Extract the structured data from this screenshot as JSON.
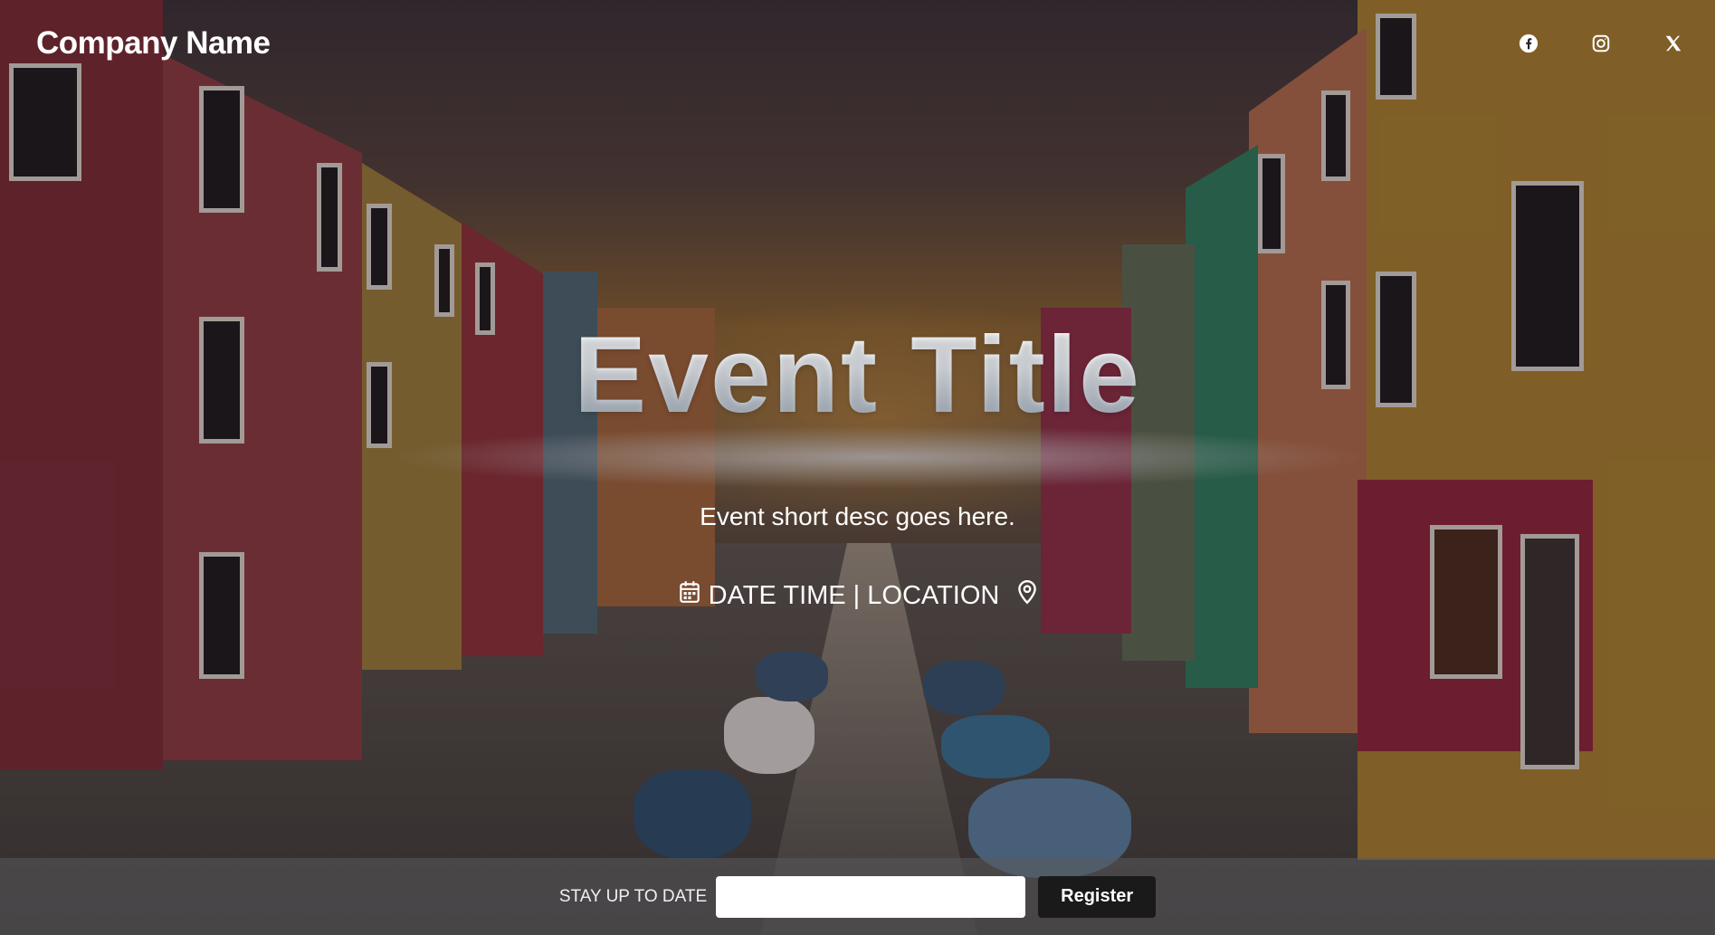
{
  "header": {
    "brand": "Company Name",
    "social": [
      {
        "name": "facebook-icon"
      },
      {
        "name": "instagram-icon"
      },
      {
        "name": "x-twitter-icon"
      }
    ]
  },
  "hero": {
    "title": "Event Title",
    "description": "Event short desc goes here.",
    "meta_text": "DATE TIME | LOCATION",
    "meta_icons": [
      "calendar-icon",
      "location-pin-icon"
    ]
  },
  "footer": {
    "label": "STAY UP TO DATE",
    "email_value": "",
    "email_placeholder": "",
    "button_label": "Register"
  },
  "colors": {
    "text": "#ffffff",
    "footer_bar": "#5a5a5c",
    "button_bg": "#1a1a1a",
    "input_bg": "#ffffff"
  }
}
